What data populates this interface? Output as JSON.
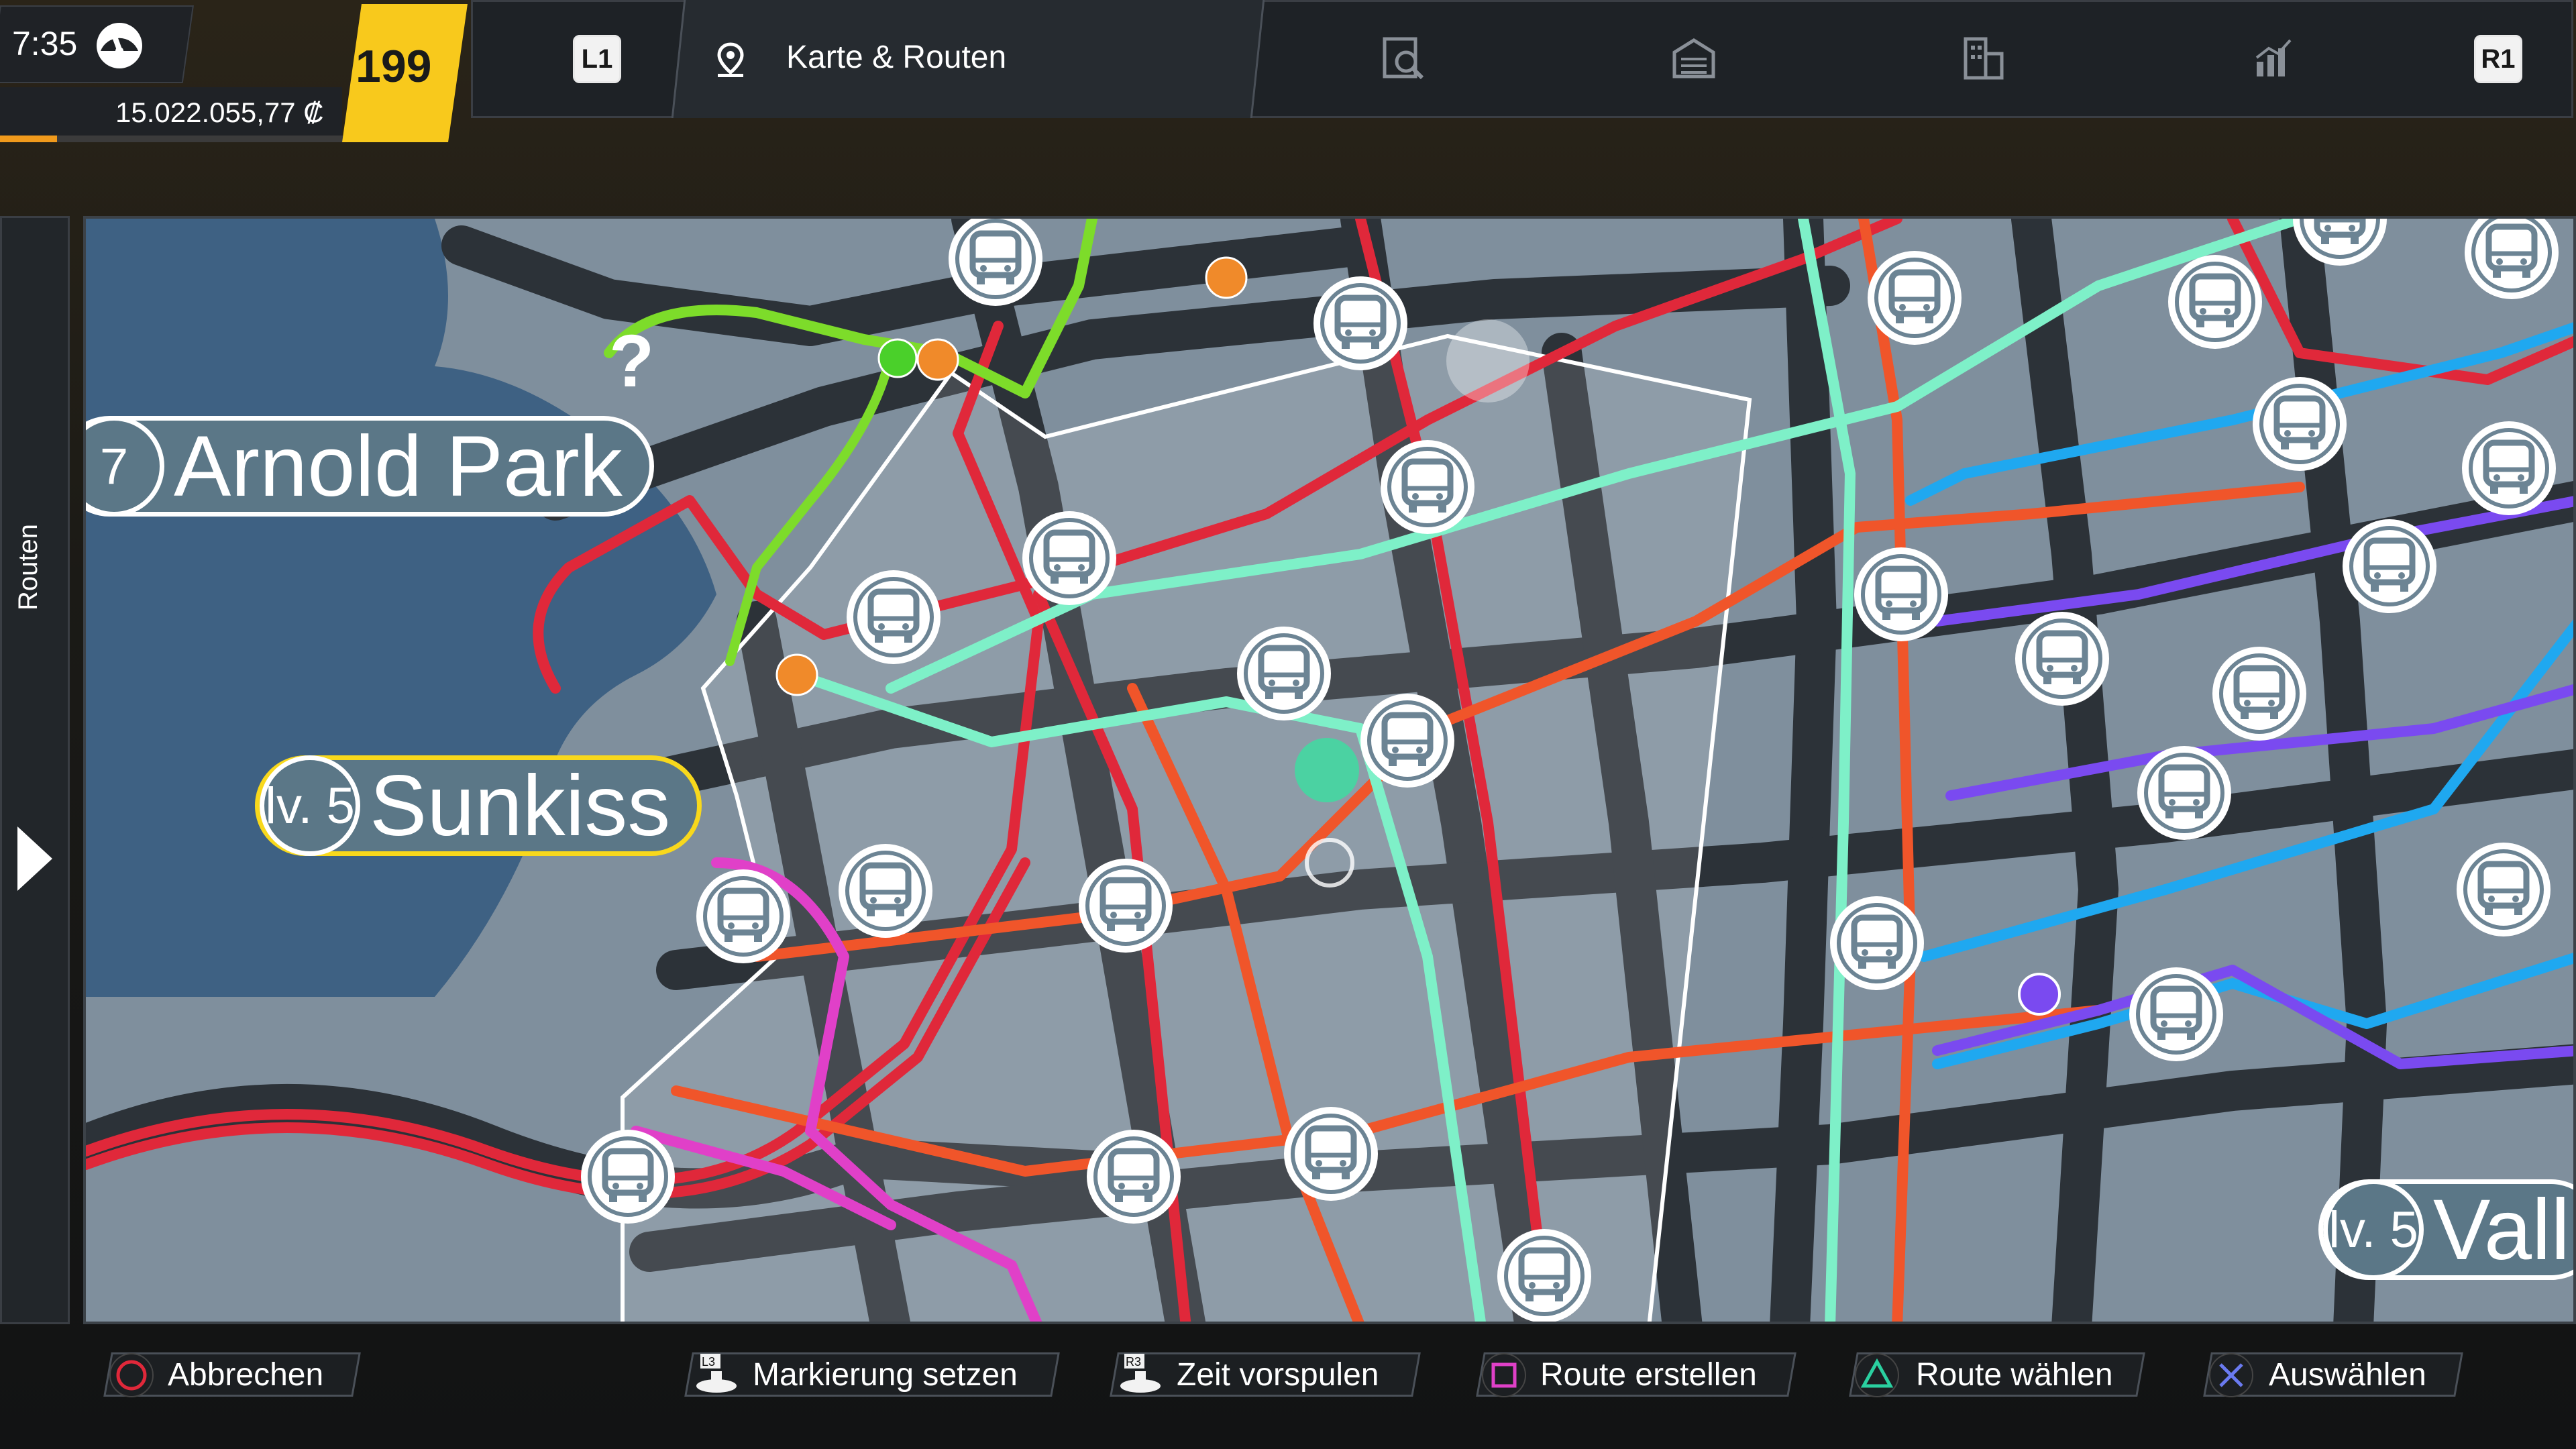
{
  "status": {
    "time": "7:35",
    "money": "15.022.055,77 ₡",
    "level": "199",
    "money_progress": 0.13
  },
  "topnav": {
    "left_button": "L1",
    "right_button": "R1",
    "active_tab": "Karte & Routen",
    "tabs": [
      {
        "icon": "map-pin-icon",
        "label": "Karte & Routen"
      },
      {
        "icon": "route-planner-icon"
      },
      {
        "icon": "depot-icon"
      },
      {
        "icon": "buildings-icon"
      },
      {
        "icon": "statistics-icon"
      }
    ]
  },
  "sidepanel": {
    "label": "Routen"
  },
  "map": {
    "locations": [
      {
        "badge": "7",
        "name": "Arnold Park"
      },
      {
        "badge": "lv. 5",
        "name": "Sunkiss"
      },
      {
        "badge": "lv. 5",
        "name": "Vall"
      }
    ],
    "colors": {
      "water": "#3e6183",
      "land": "#7f8f9d",
      "road": "#2c3238",
      "route_red": "#e0283a",
      "route_orange": "#f0552a",
      "route_mint": "#7ef0c8",
      "route_green": "#7ddc2a",
      "route_blue": "#1fa8f0",
      "route_purple": "#7a4af0",
      "route_magenta": "#e040c8"
    },
    "question_mark": "?"
  },
  "hints": [
    {
      "button": "circle",
      "label": "Abbrechen"
    },
    {
      "button": "L3",
      "label": "Markierung setzen"
    },
    {
      "button": "R3",
      "label": "Zeit vorspulen"
    },
    {
      "button": "square",
      "label": "Route erstellen"
    },
    {
      "button": "triangle",
      "label": "Route wählen"
    },
    {
      "button": "cross",
      "label": "Auswählen"
    }
  ]
}
